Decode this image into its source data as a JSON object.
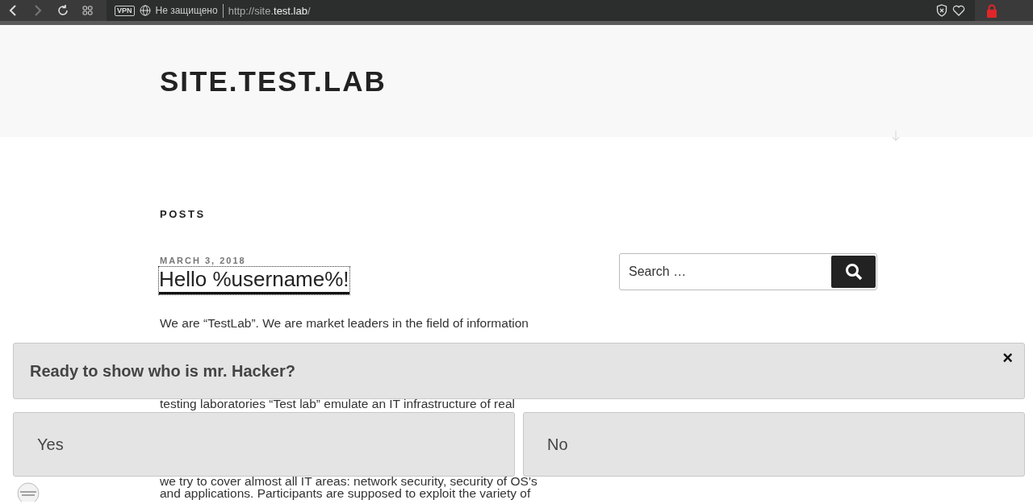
{
  "browser": {
    "back_disabled": false,
    "forward_disabled": true,
    "vpn": "VPN",
    "security": "Не защищено",
    "url": {
      "prefix": "http://site.",
      "host": "test.lab",
      "suffix": "/"
    }
  },
  "site": {
    "title": "SITE.TEST.LAB"
  },
  "posts": {
    "heading": "POSTS",
    "date": "MARCH 3, 2018",
    "title": "Hello %username%!",
    "lines": [
      "We are “TestLab”. We are market leaders in the field of information",
      "testing laboratories “Test lab” emulate an IT infrastructure of real",
      "we try to cover almost all IT areas: network security, security of OS’s",
      "and applications. Participants are supposed to exploit the variety of"
    ]
  },
  "search": {
    "placeholder": "Search …"
  },
  "prompt": {
    "question": "Ready to show who is mr. Hacker?",
    "close": "×",
    "buttons": [
      "Yes",
      "No"
    ]
  }
}
